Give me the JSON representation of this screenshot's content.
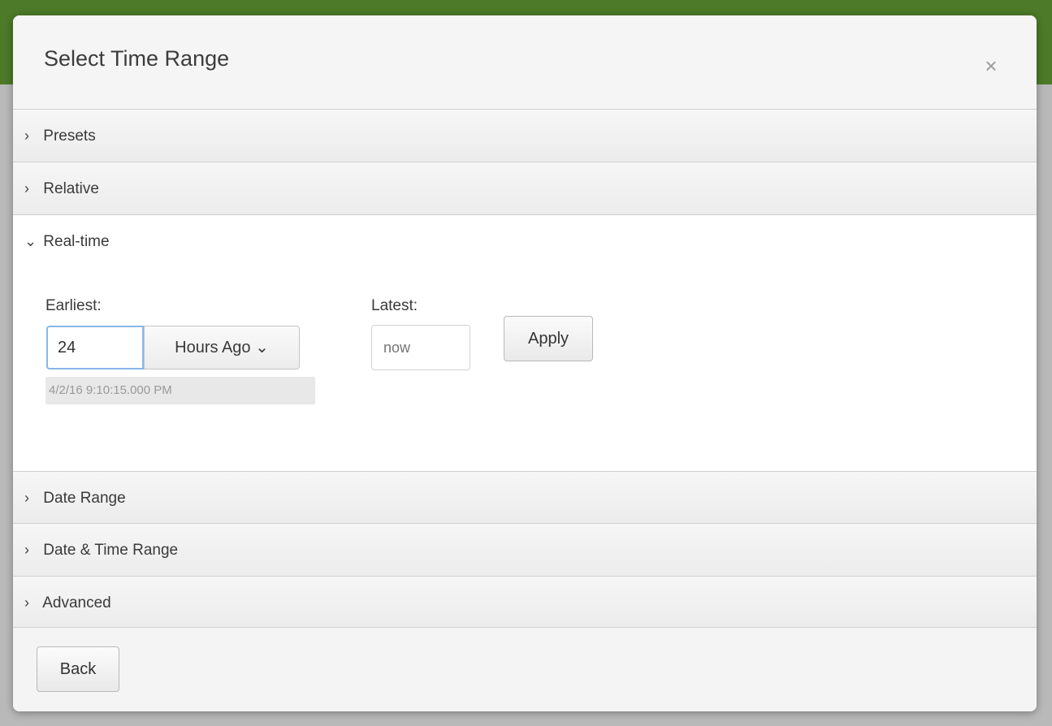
{
  "dialog": {
    "title": "Select Time Range",
    "close_icon": "×"
  },
  "sections": {
    "presets": {
      "label": "Presets",
      "chevron": "›"
    },
    "relative": {
      "label": "Relative",
      "chevron": "›"
    },
    "realtime": {
      "label": "Real-time",
      "chevron": "⌄"
    },
    "date_range": {
      "label": "Date Range",
      "chevron": "›"
    },
    "date_time_range": {
      "label": "Date & Time Range",
      "chevron": "›"
    },
    "advanced": {
      "label": "Advanced",
      "chevron": "›"
    }
  },
  "realtime": {
    "earliest_label": "Earliest:",
    "earliest_value": "24",
    "unit_label": "Hours Ago",
    "unit_chevron": "⌄",
    "earliest_hint": "4/2/16 9:10:15.000 PM",
    "latest_label": "Latest:",
    "latest_placeholder": "now",
    "apply_label": "Apply"
  },
  "footer": {
    "back_label": "Back"
  },
  "colors": {
    "topbar": "#4c7a28",
    "input_focus": "#8ab6e8"
  }
}
